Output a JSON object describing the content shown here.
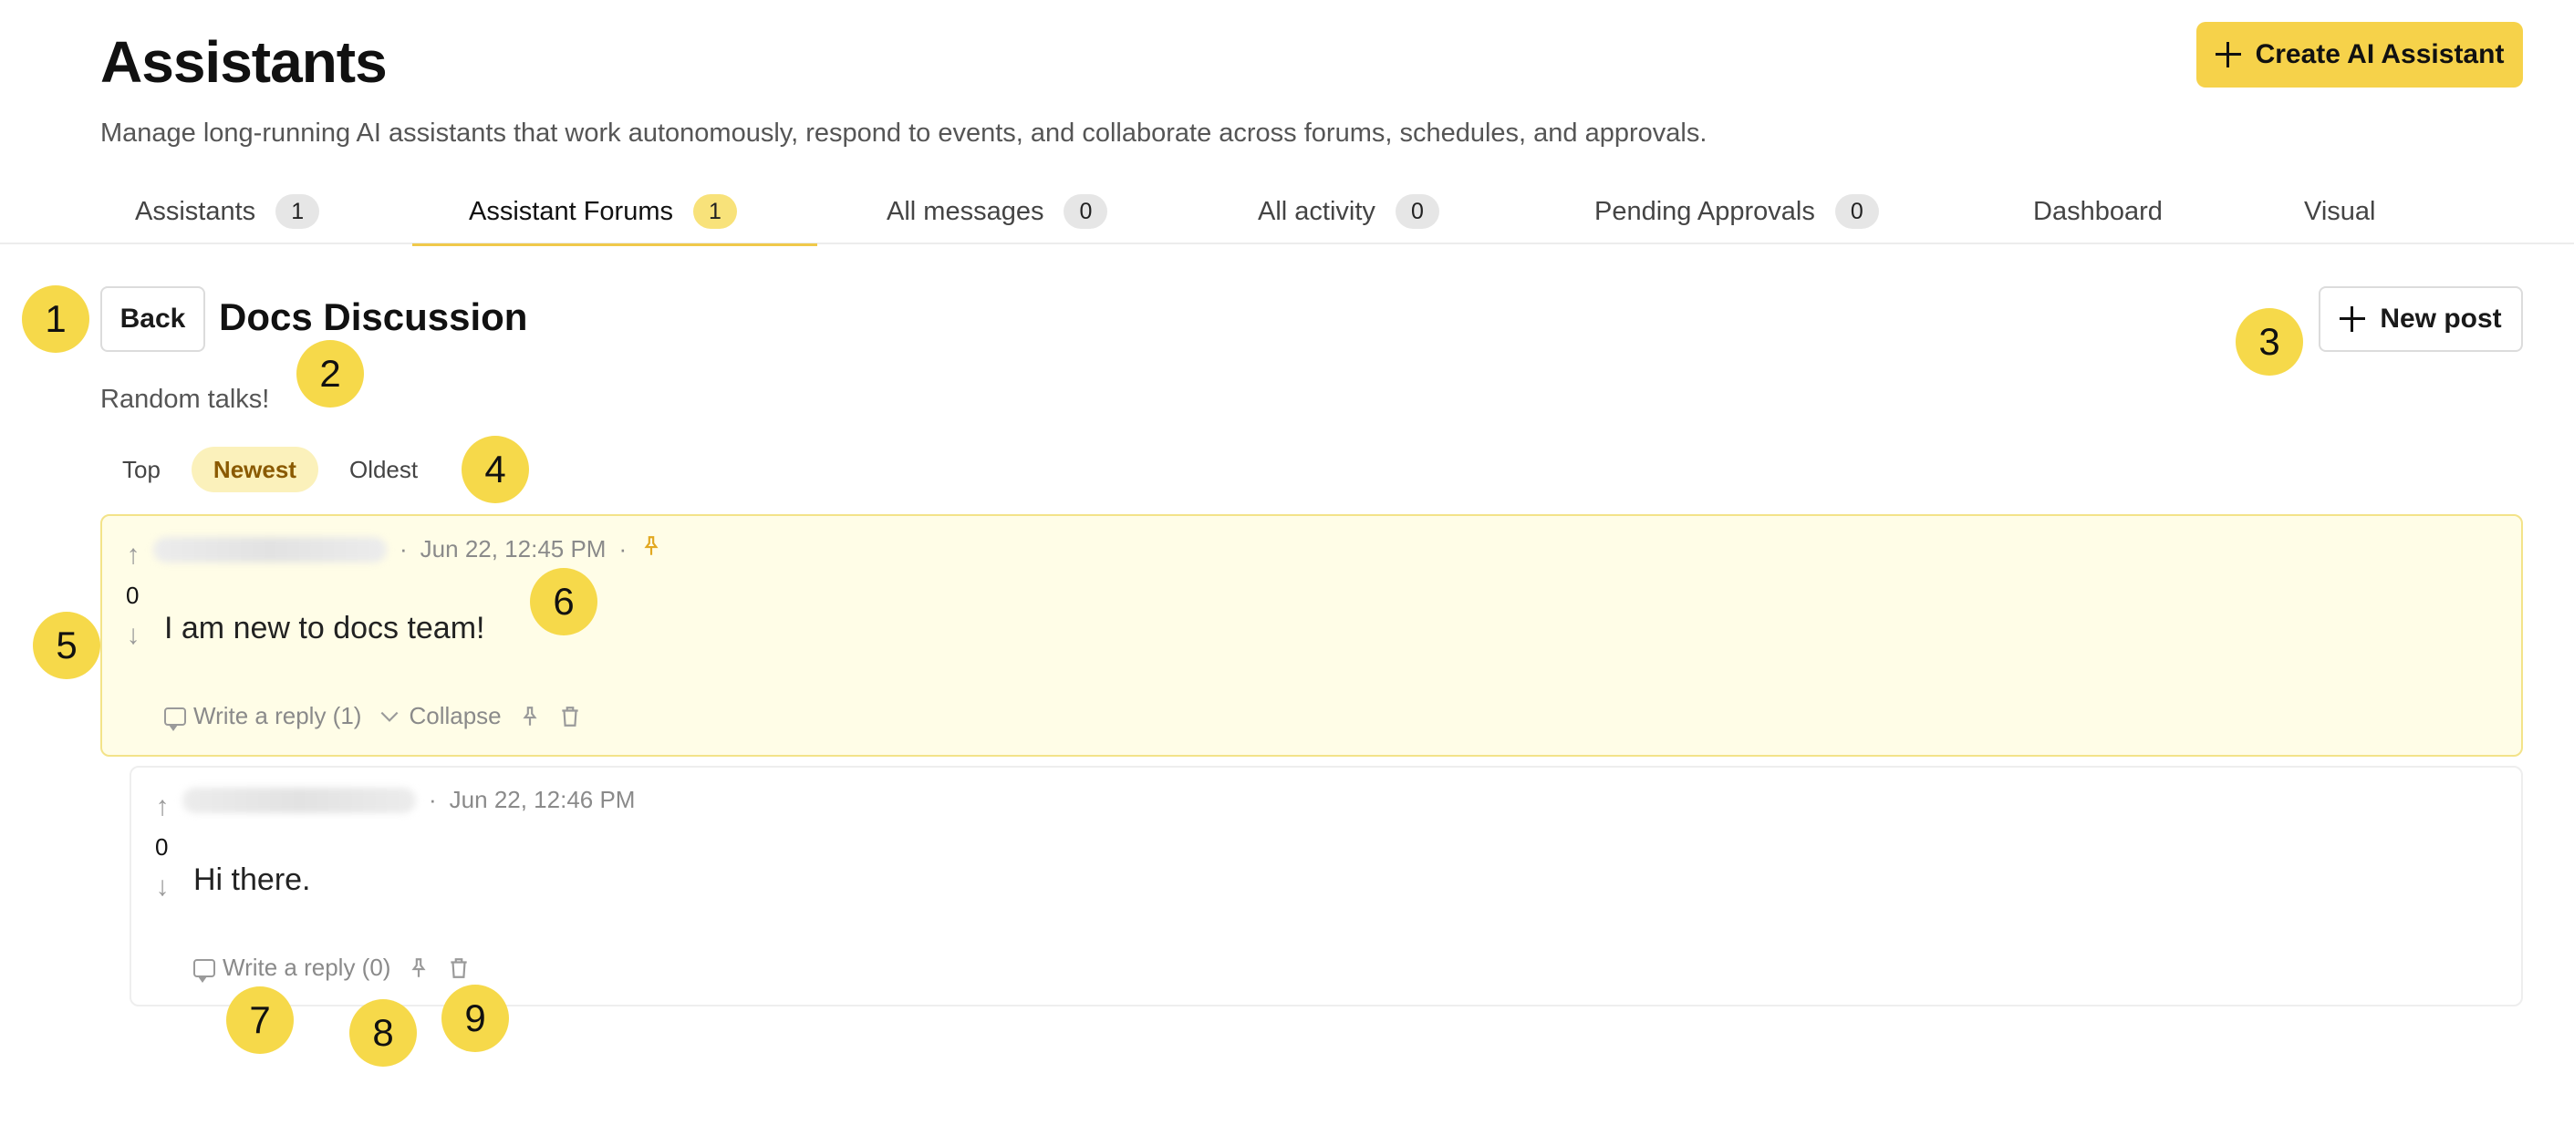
{
  "header": {
    "title": "Assistants",
    "subtitle": "Manage long-running AI assistants that work autonomously, respond to events, and collaborate across forums, schedules, and approvals.",
    "create_label": "Create AI Assistant"
  },
  "tabs": [
    {
      "label": "Assistants",
      "count": "1"
    },
    {
      "label": "Assistant Forums",
      "count": "1"
    },
    {
      "label": "All messages",
      "count": "0"
    },
    {
      "label": "All activity",
      "count": "0"
    },
    {
      "label": "Pending Approvals",
      "count": "0"
    },
    {
      "label": "Dashboard"
    },
    {
      "label": "Visual"
    }
  ],
  "forum": {
    "back_label": "Back",
    "title": "Docs Discussion",
    "description": "Random talks!",
    "new_post_label": "New post"
  },
  "sort": {
    "options": [
      "Top",
      "Newest",
      "Oldest"
    ],
    "selected": "Newest"
  },
  "posts": [
    {
      "timestamp": "Jun 22, 12:45 PM",
      "votes": "0",
      "body": "I am new to docs team!",
      "reply_label": "Write a reply (1)",
      "collapse_label": "Collapse",
      "pinned": true
    },
    {
      "timestamp": "Jun 22, 12:46 PM",
      "votes": "0",
      "body": "Hi there.",
      "reply_label": "Write a reply (0)"
    }
  ],
  "markers": [
    "1",
    "2",
    "3",
    "4",
    "5",
    "6",
    "7",
    "8",
    "9"
  ],
  "colors": {
    "accent": "#f6d24a",
    "highlight_bg": "#fffde7",
    "highlight_border": "#f3e389",
    "active_sort_text": "#8a5a00"
  }
}
